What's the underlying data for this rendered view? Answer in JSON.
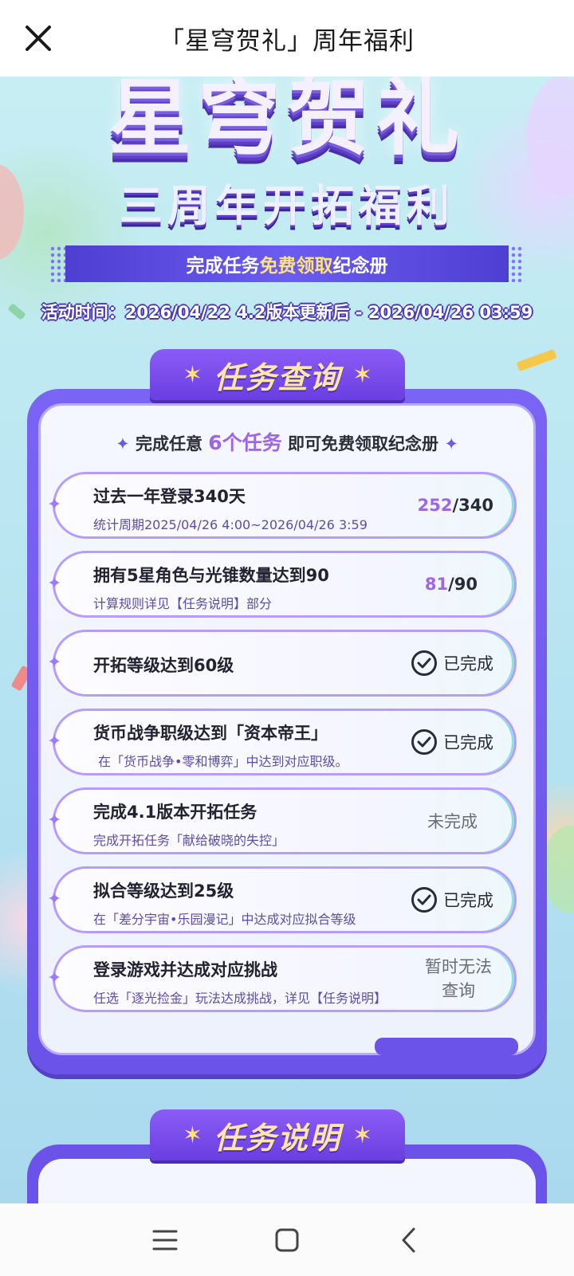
{
  "topbar": {
    "title": "「星穹贺礼」周年福利"
  },
  "banner": {
    "title": "星穹贺礼",
    "subtitle": "三周年开拓福利",
    "ribbon_prefix": "完成任务",
    "ribbon_highlight": "免费领取",
    "ribbon_suffix": "纪念册",
    "time_text": "活动时间：2026/04/22 4.2版本更新后 - 2026/04/26 03:59"
  },
  "panel": {
    "tab_label": "任务查询",
    "hint_prefix": "完成任意",
    "hint_count": "6个任务",
    "hint_suffix": "即可免费领取纪念册"
  },
  "tasks": [
    {
      "title": "过去一年登录340天",
      "subtitle": "统计周期2025/04/26 4:00~2026/04/26 3:59",
      "status_type": "progress",
      "current": "252",
      "total": "/340"
    },
    {
      "title": "拥有5星角色与光锥数量达到90",
      "subtitle": "计算规则详见【任务说明】部分",
      "status_type": "progress",
      "current": "81",
      "total": "/90"
    },
    {
      "title": "开拓等级达到60级",
      "subtitle": "",
      "status_type": "done",
      "status": "已完成"
    },
    {
      "title": "货币战争职级达到「资本帝王」",
      "subtitle": "在「货币战争•零和博弈」中达到对应职级。",
      "status_type": "done",
      "status": "已完成"
    },
    {
      "title": "完成4.1版本开拓任务",
      "subtitle": "完成开拓任务「献给破晓的失控」",
      "status_type": "text",
      "status": "未完成"
    },
    {
      "title": "拟合等级达到25级",
      "subtitle": "在「差分宇宙•乐园漫记」中达成对应拟合等级",
      "status_type": "done",
      "status": "已完成"
    },
    {
      "title": "登录游戏并达成对应挑战",
      "subtitle": "任选「逐光捡金」玩法达成挑战，详见【任务说明】",
      "status_type": "text",
      "status": "暂时无法查询"
    }
  ],
  "lower_section": {
    "tab_label": "任务说明"
  },
  "navbar": {
    "menu_icon": "menu-icon",
    "home_icon": "home-icon",
    "back_icon": "back-icon"
  }
}
